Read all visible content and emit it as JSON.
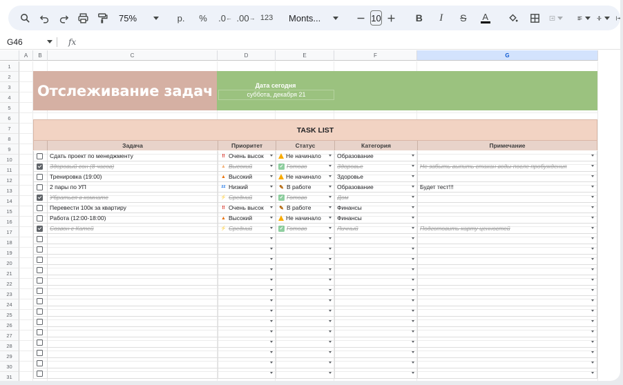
{
  "toolbar": {
    "zoom": "75%",
    "currency_format": "р.",
    "percent_format": "%",
    "decrease_decimals": ".0",
    "increase_decimals": ".00",
    "more_formats": "123",
    "font": "Monts...",
    "font_size": "10"
  },
  "formula_bar": {
    "cell_ref": "G46",
    "fx": "fx",
    "content": ""
  },
  "columns": [
    "A",
    "B",
    "C",
    "D",
    "E",
    "F",
    "G"
  ],
  "selected_column": "G",
  "row_numbers": [
    "1",
    "2",
    "3",
    "4",
    "5",
    "6",
    "7",
    "8",
    "9",
    "10",
    "11",
    "12",
    "13",
    "14",
    "15",
    "16",
    "17",
    "18",
    "19",
    "20",
    "21",
    "22",
    "23",
    "24",
    "25",
    "26",
    "27",
    "28",
    "29",
    "30",
    "31"
  ],
  "sheet": {
    "title": "Отслеживание задач",
    "date_label": "Дата сегодня",
    "date_value": "суббота, декабря 21",
    "task_list_title": "TASK LIST",
    "headers": {
      "task": "Задача",
      "priority": "Приоритет",
      "status": "Статус",
      "category": "Категория",
      "note": "Примечание"
    },
    "tasks": [
      {
        "done": false,
        "task": "Сдать проект по менеджменту",
        "priority": "Очень высок",
        "priority_icon": "double-exclamation-icon",
        "status": "Не начинало",
        "status_icon": "warning-icon",
        "category": "Образование",
        "note": ""
      },
      {
        "done": true,
        "task": "Здоровый сон (8 часов)",
        "priority": "Высокий",
        "priority_icon": "fire-icon",
        "status": "Готово",
        "status_icon": "check-mark-icon",
        "category": "Здоровье",
        "note": "Не забыть выпить стакан воды после пробуждения"
      },
      {
        "done": false,
        "task": "Тренировка (19:00)",
        "priority": "Высокий",
        "priority_icon": "fire-icon",
        "status": "Не начинало",
        "status_icon": "warning-icon",
        "category": "Здоровье",
        "note": ""
      },
      {
        "done": false,
        "task": "2 пары по УП",
        "priority": "Низкий",
        "priority_icon": "sleep-icon",
        "status": "В работе",
        "status_icon": "pencil-icon",
        "category": "Образование",
        "note": "Будет тест!!!"
      },
      {
        "done": true,
        "task": "Убраться в комнате",
        "priority": "Средний",
        "priority_icon": "lightning-icon",
        "status": "Готово",
        "status_icon": "check-mark-icon",
        "category": "Дом",
        "note": ""
      },
      {
        "done": false,
        "task": "Перевести 100к за квартиру",
        "priority": "Очень высок",
        "priority_icon": "double-exclamation-icon",
        "status": "В работе",
        "status_icon": "pencil-icon",
        "category": "Финансы",
        "note": ""
      },
      {
        "done": false,
        "task": "Работа (12:00-18:00)",
        "priority": "Высокий",
        "priority_icon": "fire-icon",
        "status": "Не начинало",
        "status_icon": "warning-icon",
        "category": "Финансы",
        "note": ""
      },
      {
        "done": true,
        "task": "Созвон с Катей",
        "priority": "Средний",
        "priority_icon": "lightning-icon",
        "status": "Готово",
        "status_icon": "check-mark-icon",
        "category": "Личный",
        "note": "Подготовить карту ценностей"
      }
    ],
    "empty_rows": 14
  },
  "colors": {
    "title_bg": "#d5b0a3",
    "date_bg": "#9bc27f",
    "task_header_bg": "#f2d3c3",
    "column_header_bg": "#e8d3ca",
    "selected_column": "#d3e3fd"
  }
}
